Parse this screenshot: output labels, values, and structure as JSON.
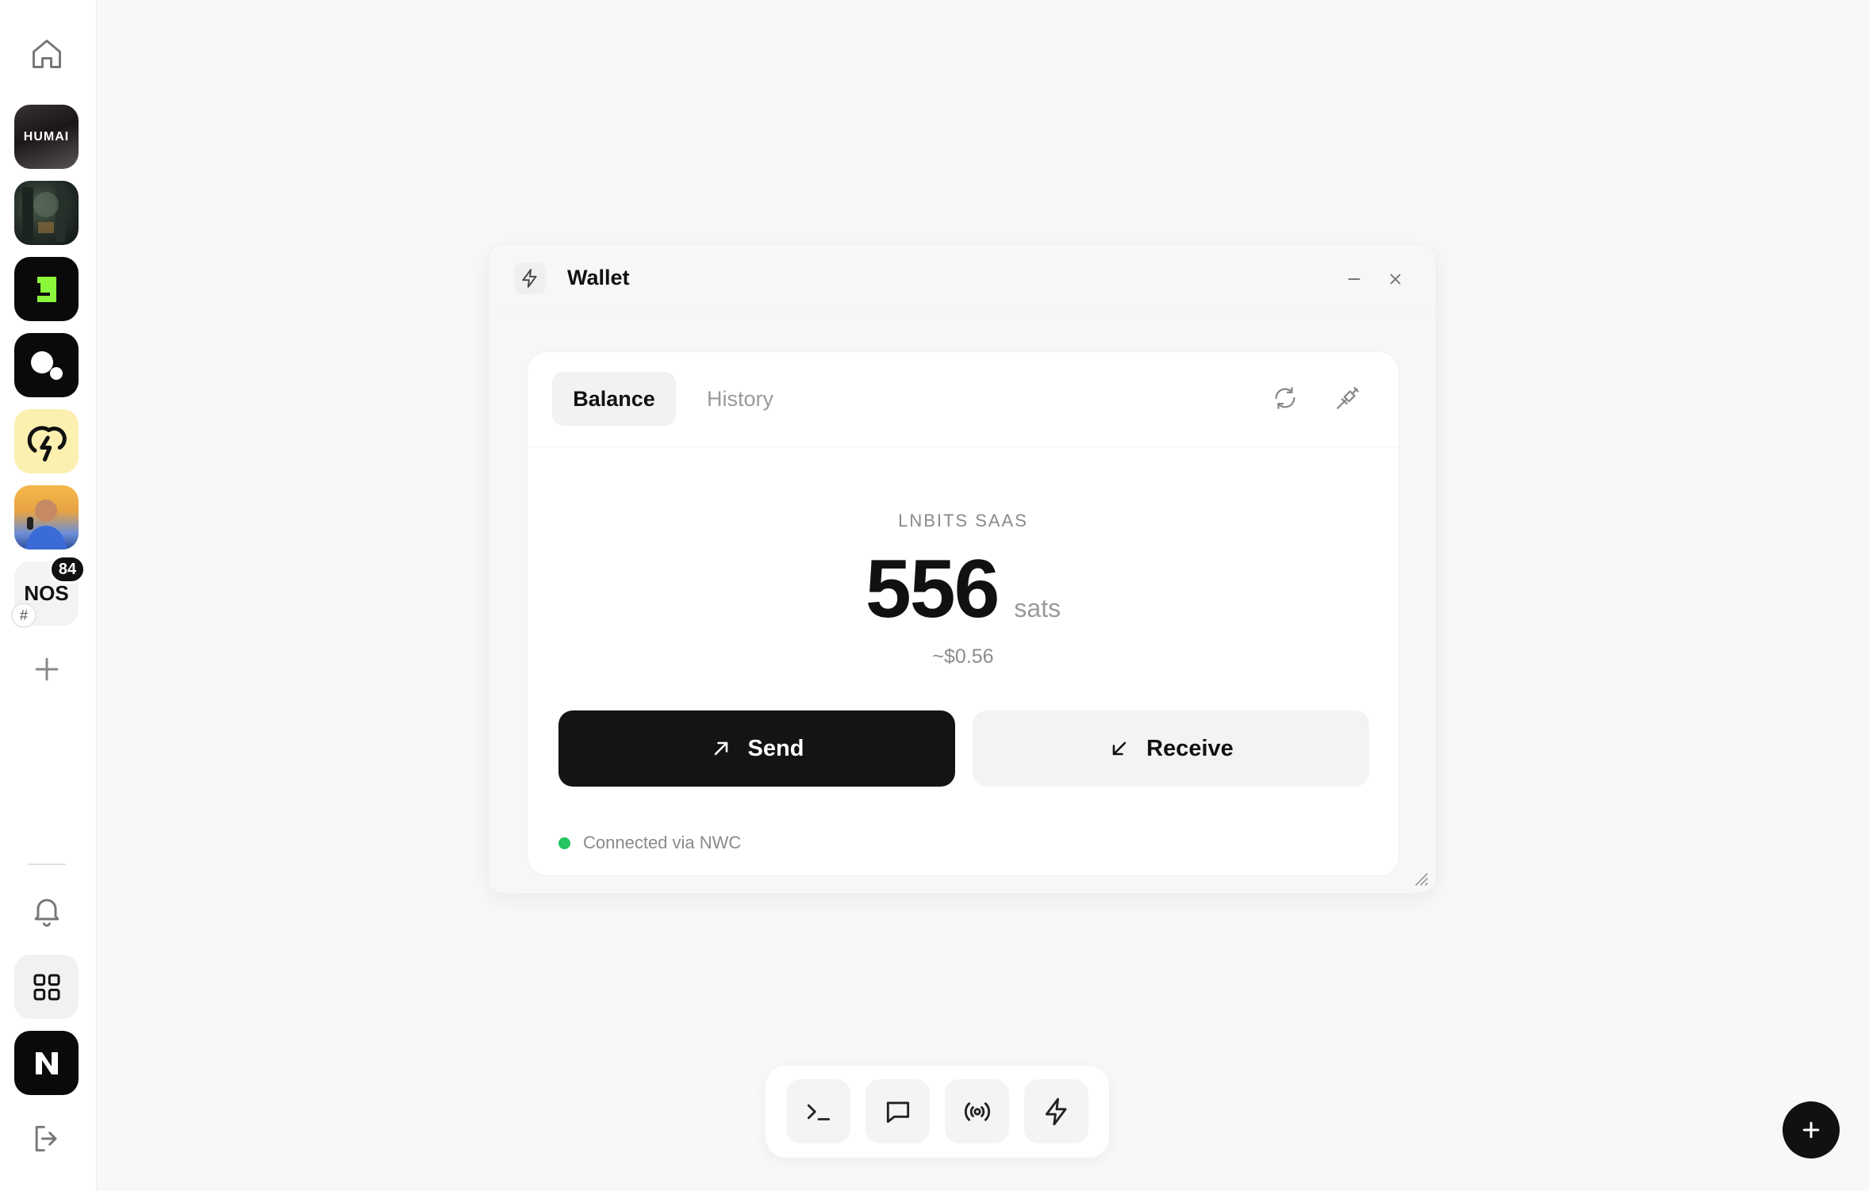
{
  "sidebar": {
    "apps": [
      {
        "name": "humai",
        "label": "HUMAI"
      },
      {
        "name": "forest",
        "label": ""
      },
      {
        "name": "green-logo",
        "label": ""
      },
      {
        "name": "dots-logo",
        "label": ""
      },
      {
        "name": "lightning-cloud",
        "label": ""
      },
      {
        "name": "person-avatar",
        "label": ""
      },
      {
        "name": "nos",
        "label": "NOS",
        "badge": "84",
        "sub_icon": "#"
      }
    ],
    "icons": [
      "home-icon",
      "plus-icon",
      "bell-icon",
      "grid-icon",
      "n-logo",
      "logout-icon"
    ]
  },
  "window": {
    "title": "Wallet",
    "tabs": [
      {
        "label": "Balance",
        "active": true
      },
      {
        "label": "History",
        "active": false
      }
    ],
    "wallet_name": "LNBITS SAAS",
    "balance": "556",
    "unit": "sats",
    "fiat": "~$0.56",
    "send_label": "Send",
    "receive_label": "Receive",
    "status_text": "Connected via NWC",
    "status_color": "#22c55e"
  },
  "toolbar": {
    "items": [
      "terminal-icon",
      "chat-icon",
      "broadcast-icon",
      "lightning-icon"
    ]
  },
  "colors": {
    "accent": "#141414",
    "background": "#f8f8f8",
    "neon_green": "#8bf73a"
  }
}
